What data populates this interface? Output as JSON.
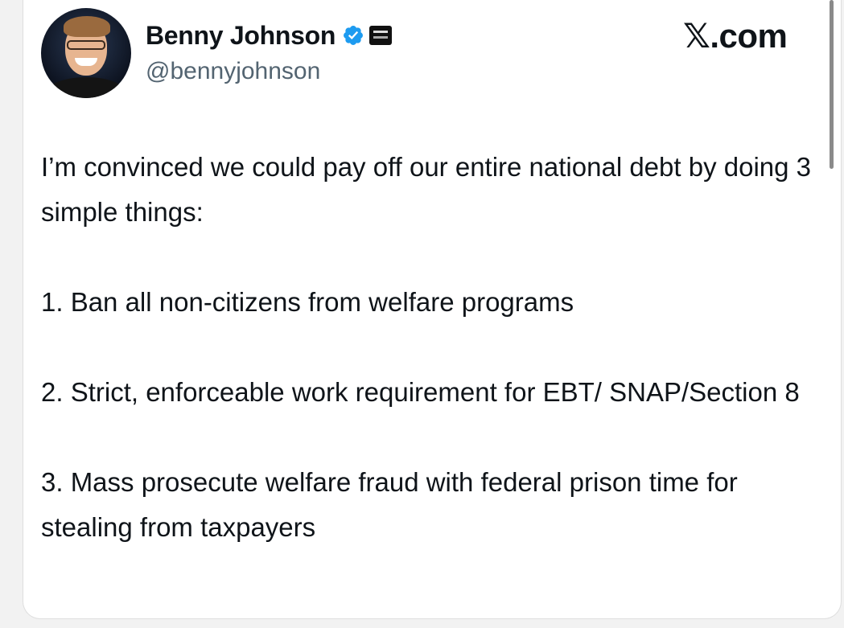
{
  "author": {
    "display_name": "Benny Johnson",
    "handle": "@bennyjohnson",
    "verified": true,
    "avatar_icon": "profile-photo",
    "badge_icon": "affiliate-badge-icon"
  },
  "source": {
    "label": "𝕏.com"
  },
  "tweet": {
    "intro": "I’m convinced we could pay off our entire national debt by doing 3 simple things:",
    "items": [
      "1. Ban all non-citizens from welfare programs",
      "2. Strict, enforceable work requirement for EBT/ SNAP/Section 8",
      "3. Mass prosecute welfare fraud with federal prison time for stealing from taxpayers"
    ]
  },
  "colors": {
    "verified_blue": "#1d9bf0",
    "text_primary": "#0f1419",
    "text_secondary": "#536471"
  }
}
